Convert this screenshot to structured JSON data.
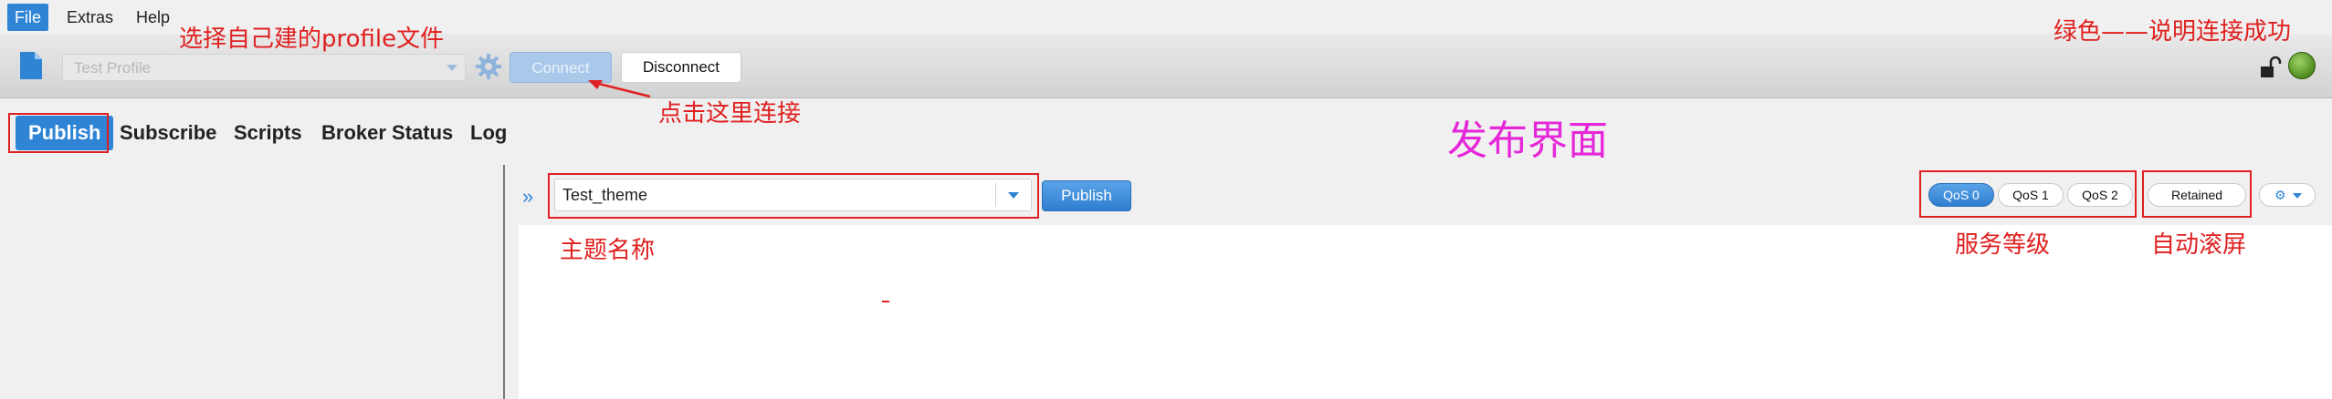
{
  "menu": {
    "items": [
      "File",
      "Extras",
      "Help"
    ]
  },
  "toolbar": {
    "profile_value": "Test Profile",
    "connect_label": "Connect",
    "disconnect_label": "Disconnect"
  },
  "tabs": [
    "Publish",
    "Subscribe",
    "Scripts",
    "Broker Status",
    "Log"
  ],
  "publish": {
    "topic_value": "Test_theme",
    "publish_label": "Publish",
    "qos": [
      "QoS 0",
      "QoS 1",
      "QoS 2"
    ],
    "qos_selected": "QoS 0",
    "retained_label": "Retained"
  },
  "annotations": {
    "profile_note": "选择自己建的profile文件",
    "connect_note": "点击这里连接",
    "status_note": "绿色——说明连接成功",
    "page_note": "发布界面",
    "topic_note": "主题名称",
    "qos_note": "服务等级",
    "retained_note": "自动滚屏"
  },
  "colors": {
    "accent": "#2f84d6",
    "annotation": "#e02020",
    "page_note": "#e627d9",
    "status_ok": "#5a9e2a"
  }
}
